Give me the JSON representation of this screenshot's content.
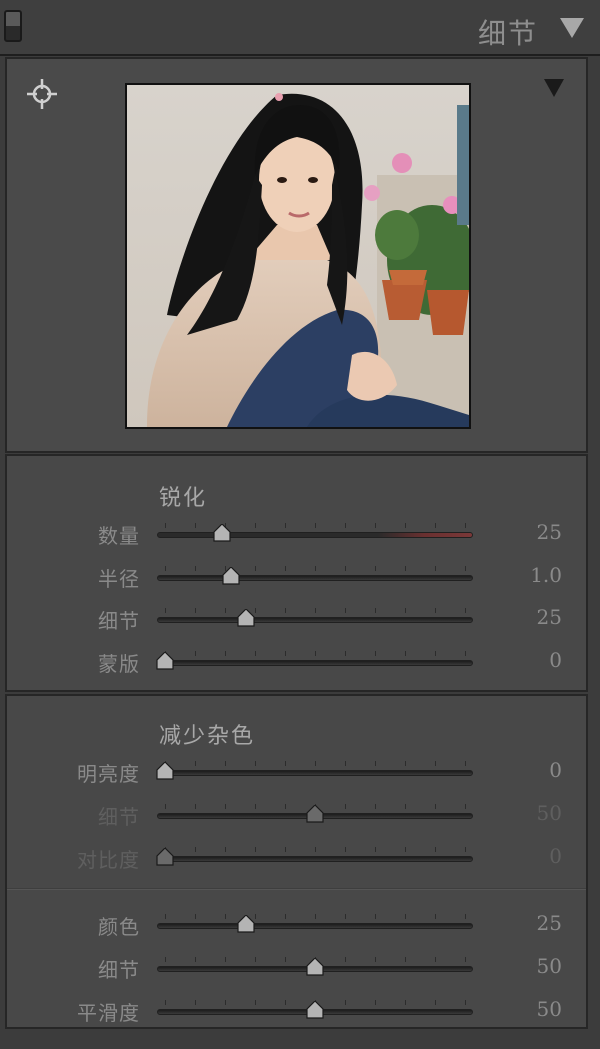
{
  "header": {
    "title": "细节"
  },
  "sharpening": {
    "title": "锐化",
    "rows": [
      {
        "label": "数量",
        "value": "25",
        "fraction": 0.19,
        "accent": true
      },
      {
        "label": "半径",
        "value": "1.0",
        "fraction": 0.22
      },
      {
        "label": "细节",
        "value": "25",
        "fraction": 0.27
      },
      {
        "label": "蒙版",
        "value": "0",
        "fraction": 0.0
      }
    ]
  },
  "noise_reduction": {
    "title": "减少杂色",
    "luminance_rows": [
      {
        "label": "明亮度",
        "value": "0",
        "fraction": 0.0
      },
      {
        "label": "细节",
        "value": "50",
        "fraction": 0.5,
        "disabled": true
      },
      {
        "label": "对比度",
        "value": "0",
        "fraction": 0.0,
        "disabled": true
      }
    ],
    "color_rows": [
      {
        "label": "颜色",
        "value": "25",
        "fraction": 0.27
      },
      {
        "label": "细节",
        "value": "50",
        "fraction": 0.5
      },
      {
        "label": "平滑度",
        "value": "50",
        "fraction": 0.5
      }
    ]
  },
  "colors": {
    "panel_bg": "#484848",
    "track": "#1c1c1c",
    "thumb": "#b0b0b0",
    "accent_track": "#7a3838"
  }
}
